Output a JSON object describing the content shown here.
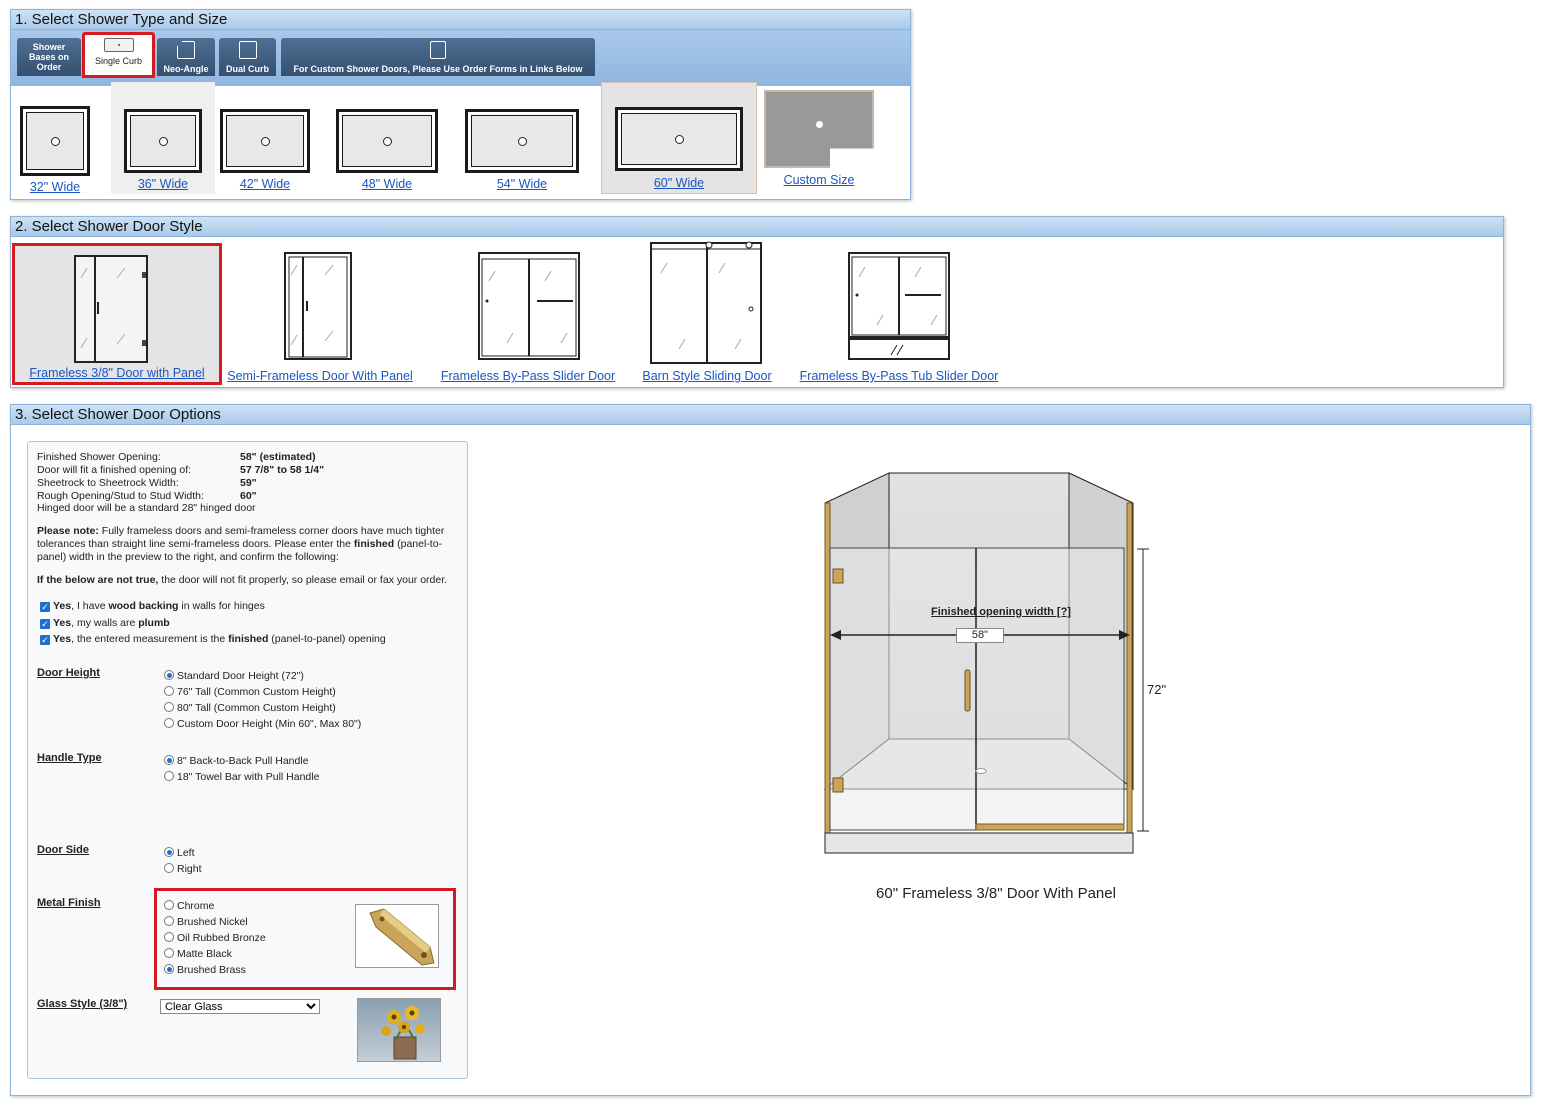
{
  "section1": {
    "title": "1. Select Shower Type and Size",
    "tabs": [
      {
        "label": "Shower Bases on Order",
        "active": false
      },
      {
        "label": "Single Curb",
        "active": true
      },
      {
        "label": "Neo-Angle",
        "active": false
      },
      {
        "label": "Dual Curb",
        "active": false
      },
      {
        "label": "For Custom Shower Doors, Please Use Order Forms in Links Below",
        "active": false
      }
    ],
    "sizes": [
      "32\" Wide",
      "36\" Wide",
      "42\" Wide",
      "48\" Wide",
      "54\" Wide",
      "60\" Wide",
      "Custom Size"
    ],
    "selected_size": "60\" Wide"
  },
  "section2": {
    "title": "2. Select Shower Door Style",
    "styles": [
      "Frameless 3/8\" Door with Panel",
      "Semi-Frameless Door With Panel",
      "Frameless By-Pass Slider Door",
      "Barn Style Sliding Door",
      "Frameless By-Pass Tub Slider Door"
    ],
    "selected_style": "Frameless 3/8\" Door with Panel"
  },
  "section3": {
    "title": "3. Select Shower Door Options",
    "specs": [
      {
        "label": "Finished Shower Opening:",
        "value": "58\" (estimated)"
      },
      {
        "label": "Door will fit a finished opening of:",
        "value": "57 7/8\" to 58 1/4\""
      },
      {
        "label": "Sheetrock to Sheetrock Width:",
        "value": "59\""
      },
      {
        "label": "Rough Opening/Stud to Stud Width:",
        "value": "60\""
      }
    ],
    "hinged_note": "Hinged door will be a standard 28\" hinged door",
    "note_bold": "Please note:",
    "note_line1": " Fully frameless doors and semi-frameless corner doors have much tighter",
    "note_line2a": "tolerances than straight line semi-frameless doors. Please enter the ",
    "note_line2b": "finished",
    "note_line2c": " (panel-to-",
    "note_line3": "panel) width in the preview to the right, and confirm the following:",
    "warn_bold": "If the below are not true,",
    "warn_rest": " the door will not fit properly, so please email or fax your order.",
    "checks": [
      {
        "yes": "Yes",
        "pre": ", I have ",
        "bold": "wood backing",
        "post": " in walls for hinges"
      },
      {
        "yes": "Yes",
        "pre": ", my walls are ",
        "bold": "plumb",
        "post": ""
      },
      {
        "yes": "Yes",
        "pre": ", the entered measurement is the ",
        "bold": "finished",
        "post": " (panel-to-panel) opening"
      }
    ],
    "door_height": {
      "label": "Door Height",
      "options": [
        "Standard Door Height (72\")",
        "76\" Tall (Common Custom Height)",
        "80\" Tall (Common Custom Height)",
        "Custom Door Height (Min 60\", Max 80\")"
      ],
      "selected": "Standard Door Height (72\")"
    },
    "handle_type": {
      "label": "Handle Type",
      "options": [
        "8\" Back-to-Back Pull Handle",
        "18\" Towel Bar with Pull Handle"
      ],
      "selected": "8\" Back-to-Back Pull Handle"
    },
    "door_side": {
      "label": "Door Side",
      "options": [
        "Left",
        "Right"
      ],
      "selected": "Left"
    },
    "metal_finish": {
      "label": "Metal Finish",
      "options": [
        "Chrome",
        "Brushed Nickel",
        "Oil Rubbed Bronze",
        "Matte Black",
        "Brushed Brass"
      ],
      "selected": "Brushed Brass"
    },
    "glass_style": {
      "label": "Glass Style (3/8\")",
      "value": "Clear Glass"
    },
    "preview": {
      "opening_label": "Finished opening width [?]",
      "opening_value": "58\"",
      "height_label": "72\"",
      "caption": "60\" Frameless 3/8\" Door With Panel"
    }
  },
  "colors": {
    "accent_red": "#d71920",
    "link_blue": "#1a56c4",
    "brass": "#c9a45a",
    "header_blue": "#a9c9ea"
  }
}
